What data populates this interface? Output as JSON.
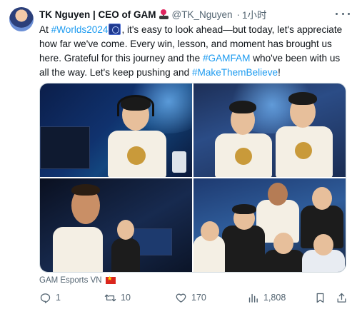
{
  "author": {
    "name": "TK Nguyen | CEO of GAM",
    "handle": "@TK_Nguyen",
    "separator": "·",
    "time": "1小时"
  },
  "tweet": {
    "t1": "At ",
    "tag1": "#Worlds2024",
    "t2": ", it's easy to look ahead—but today, let's appreciate how far we've come. Every win, lesson, and moment has brought us here. Grateful for this journey and the ",
    "tag2": "#GAMFAM",
    "t3": " who've been with us all the way. Let's keep pushing and ",
    "tag3": "#MakeThemBelieve",
    "t4": "!"
  },
  "media_caption": "GAM Esports VN",
  "actions": {
    "replies": "1",
    "retweets": "10",
    "likes": "170",
    "views": "1,808"
  },
  "colors": {
    "link": "#1d9bf0",
    "muted": "#536471",
    "text": "#0f1419"
  },
  "icons": [
    "joystick-icon",
    "more-icon",
    "reply-icon",
    "retweet-icon",
    "like-icon",
    "views-icon",
    "bookmark-icon",
    "share-icon",
    "vietnam-flag-icon"
  ]
}
